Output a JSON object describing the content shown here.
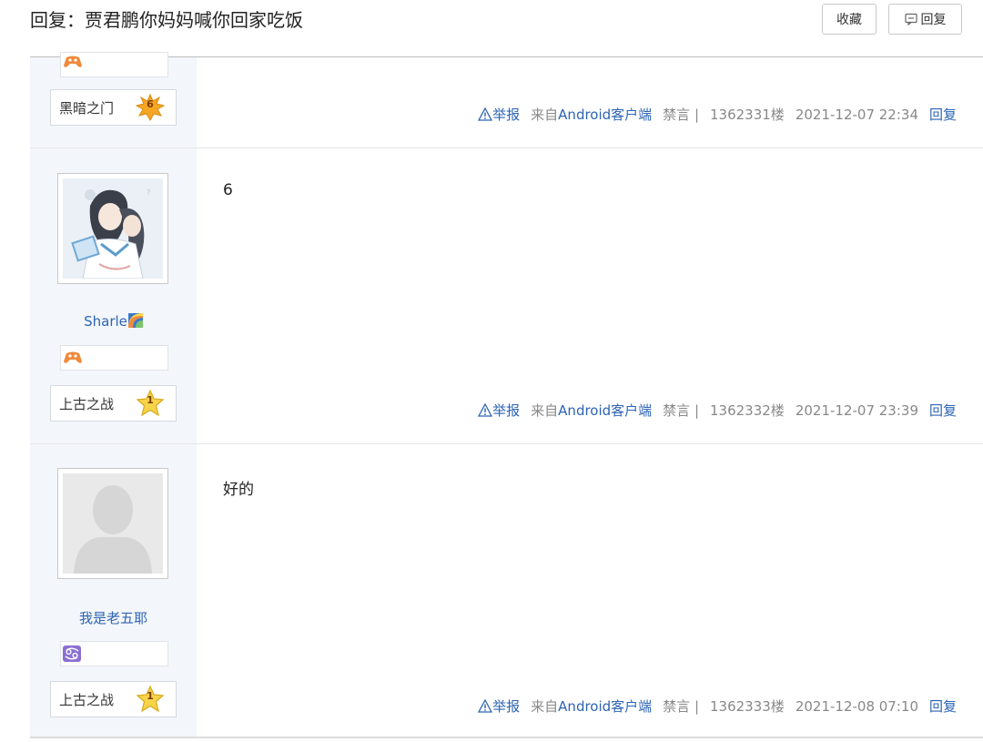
{
  "header": {
    "title": "回复：贾君鹏你妈妈喊你回家吃饭",
    "fav_label": "收藏",
    "reply_label": "回复",
    "reply_icon": "comment-icon"
  },
  "posts": [
    {
      "level_name": "黑暗之门",
      "level": "6",
      "report": "举报",
      "source_prefix": "来自",
      "source_link": "Android客户端",
      "ban": "禁言 |",
      "floor": "1362331楼",
      "time": "2021-12-07 22:34",
      "reply": "回复"
    },
    {
      "username": "Sharle",
      "content": "6",
      "level_name": "上古之战",
      "level": "1",
      "report": "举报",
      "source_prefix": "来自",
      "source_link": "Android客户端",
      "ban": "禁言 |",
      "floor": "1362332楼",
      "time": "2021-12-07 23:39",
      "reply": "回复"
    },
    {
      "username": "我是老五耶",
      "content": "好的",
      "level_name": "上古之战",
      "level": "1",
      "report": "举报",
      "source_prefix": "来自",
      "source_link": "Android客户端",
      "ban": "禁言 |",
      "floor": "1362333楼",
      "time": "2021-12-08 07:10",
      "reply": "回复"
    }
  ],
  "colors": {
    "link": "#2d64b3",
    "sidebar_bg": "#f3f6fa",
    "level_star_orange": "#f5a623",
    "level_star_yellow": "#f7d44a"
  }
}
